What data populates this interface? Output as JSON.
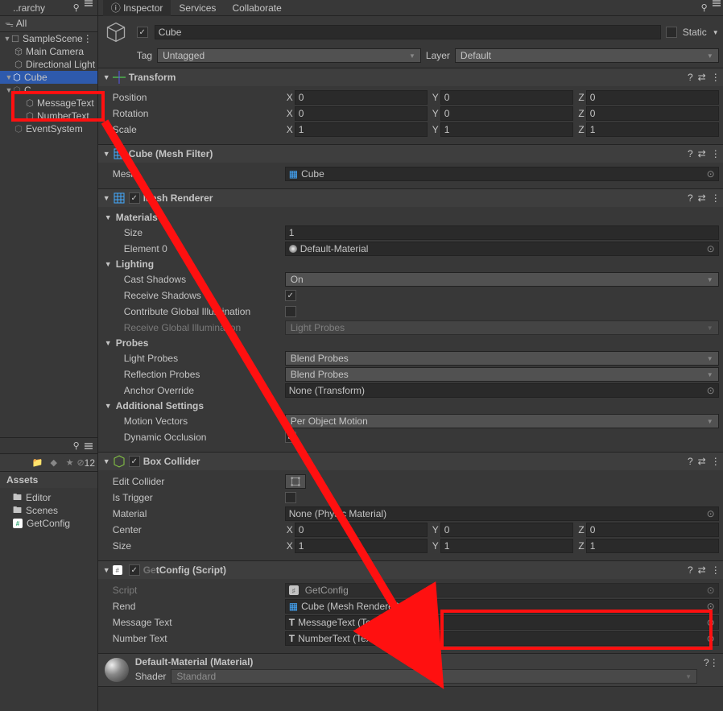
{
  "hierarchy": {
    "tab": "..rarchy",
    "search": "All",
    "scene": "SampleScene",
    "items": [
      "Main Camera",
      "Directional Light",
      "Cube",
      "C..",
      "MessageText",
      "NumberText",
      "EventSystem"
    ]
  },
  "assets": {
    "title": "Assets",
    "count": "12",
    "items": [
      "Editor",
      "Scenes",
      "GetConfig"
    ]
  },
  "inspector": {
    "tabs": [
      "Inspector",
      "Services",
      "Collaborate"
    ],
    "name": "Cube",
    "static": "Static",
    "tagLabel": "Tag",
    "tagValue": "Untagged",
    "layerLabel": "Layer",
    "layerValue": "Default"
  },
  "transform": {
    "title": "Transform",
    "positionLabel": "Position",
    "rotationLabel": "Rotation",
    "scaleLabel": "Scale",
    "px": "0",
    "py": "0",
    "pz": "0",
    "rx": "0",
    "ry": "0",
    "rz": "0",
    "sx": "1",
    "sy": "1",
    "sz": "1"
  },
  "meshFilter": {
    "title": "Cube (Mesh Filter)",
    "meshLabel": "Mesh",
    "meshValue": "Cube"
  },
  "meshRenderer": {
    "title": "Mesh Renderer",
    "materials": "Materials",
    "sizeLabel": "Size",
    "sizeValue": "1",
    "elem0Label": "Element 0",
    "elem0Value": "Default-Material",
    "lighting": "Lighting",
    "castShadows": "Cast Shadows",
    "castShadowsVal": "On",
    "recvShadows": "Receive Shadows",
    "contribGI": "Contribute Global Illumination",
    "recvGI": "Receive Global Illumination",
    "recvGIVal": "Light Probes",
    "probes": "Probes",
    "lightProbes": "Light Probes",
    "lightProbesVal": "Blend Probes",
    "reflProbes": "Reflection Probes",
    "reflProbesVal": "Blend Probes",
    "anchor": "Anchor Override",
    "anchorVal": "None (Transform)",
    "addl": "Additional Settings",
    "motion": "Motion Vectors",
    "motionVal": "Per Object Motion",
    "dynOcc": "Dynamic Occlusion"
  },
  "boxCollider": {
    "title": "Box Collider",
    "editLabel": "Edit Collider",
    "trigger": "Is Trigger",
    "matLabel": "Material",
    "matVal": "None (Physic Material)",
    "center": "Center",
    "cx": "0",
    "cy": "0",
    "cz": "0",
    "size": "Size",
    "sx": "1",
    "sy": "1",
    "sz": "1"
  },
  "getConfig": {
    "title": "GetConfig (Script)",
    "scriptLabel": "Script",
    "scriptVal": "GetConfig",
    "rendLabel": "Rend",
    "rendVal": "Cube (Mesh Renderer)",
    "msgLabel": "Message Text",
    "msgVal": "MessageText (Text)",
    "numLabel": "Number Text",
    "numVal": "NumberText (Text)"
  },
  "material": {
    "name": "Default-Material (Material)",
    "shaderLabel": "Shader",
    "shaderVal": "Standard"
  }
}
